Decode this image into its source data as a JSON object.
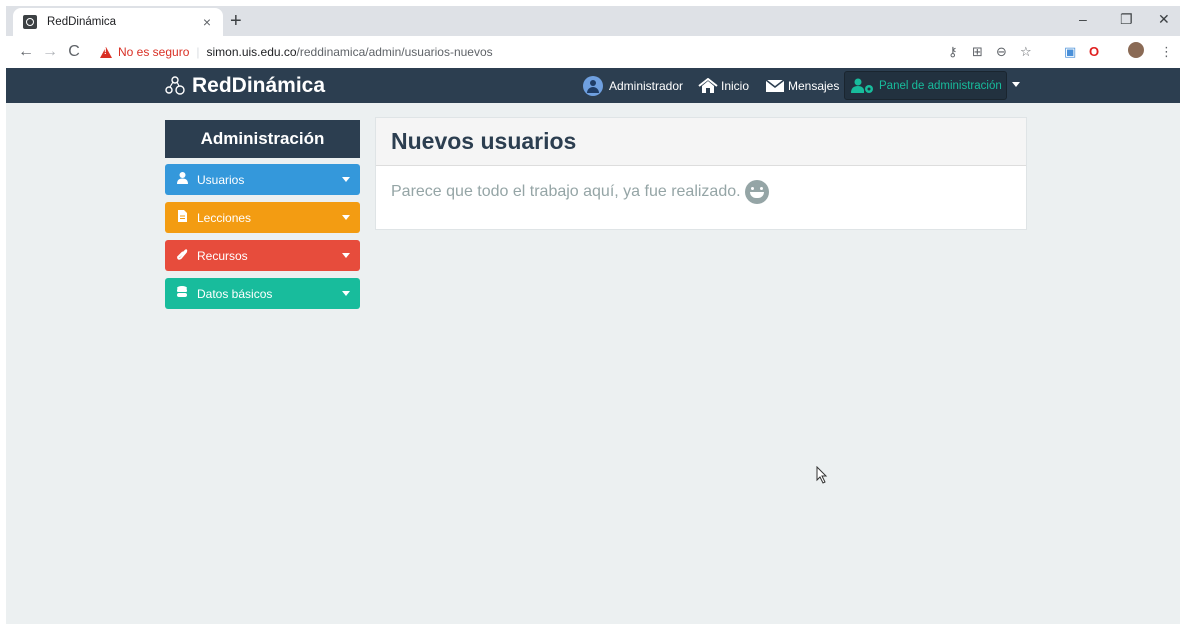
{
  "browser": {
    "tab_title": "RedDinámica",
    "tab_close": "×",
    "new_tab": "+",
    "win_minimize": "–",
    "win_restore": "❐",
    "win_close": "✕",
    "back": "←",
    "forward": "→",
    "reload": "C",
    "security_text": "No es seguro",
    "url_domain": "simon.uis.edu.co",
    "url_path": "/reddinamica/admin/usuarios-nuevos",
    "menu": "⋮"
  },
  "navbar": {
    "brand": "RedDinámica",
    "user": "Administrador",
    "home": "Inicio",
    "messages": "Mensajes",
    "admin_panel": "Panel de administración"
  },
  "sidebar": {
    "header": "Administración",
    "items": [
      {
        "label": "Usuarios",
        "color": "#3498db",
        "icon": "user-icon"
      },
      {
        "label": "Lecciones",
        "color": "#f39c12",
        "icon": "file-icon"
      },
      {
        "label": "Recursos",
        "color": "#e74c3c",
        "icon": "paperclip-icon"
      },
      {
        "label": "Datos básicos",
        "color": "#18bc9c",
        "icon": "database-icon"
      }
    ]
  },
  "main": {
    "title": "Nuevos usuarios",
    "message": "Parece que todo el trabajo aquí, ya fue realizado."
  },
  "colors": {
    "navbar": "#2c3e50",
    "background": "#ecf0f1",
    "accent_green": "#18bc9c"
  }
}
